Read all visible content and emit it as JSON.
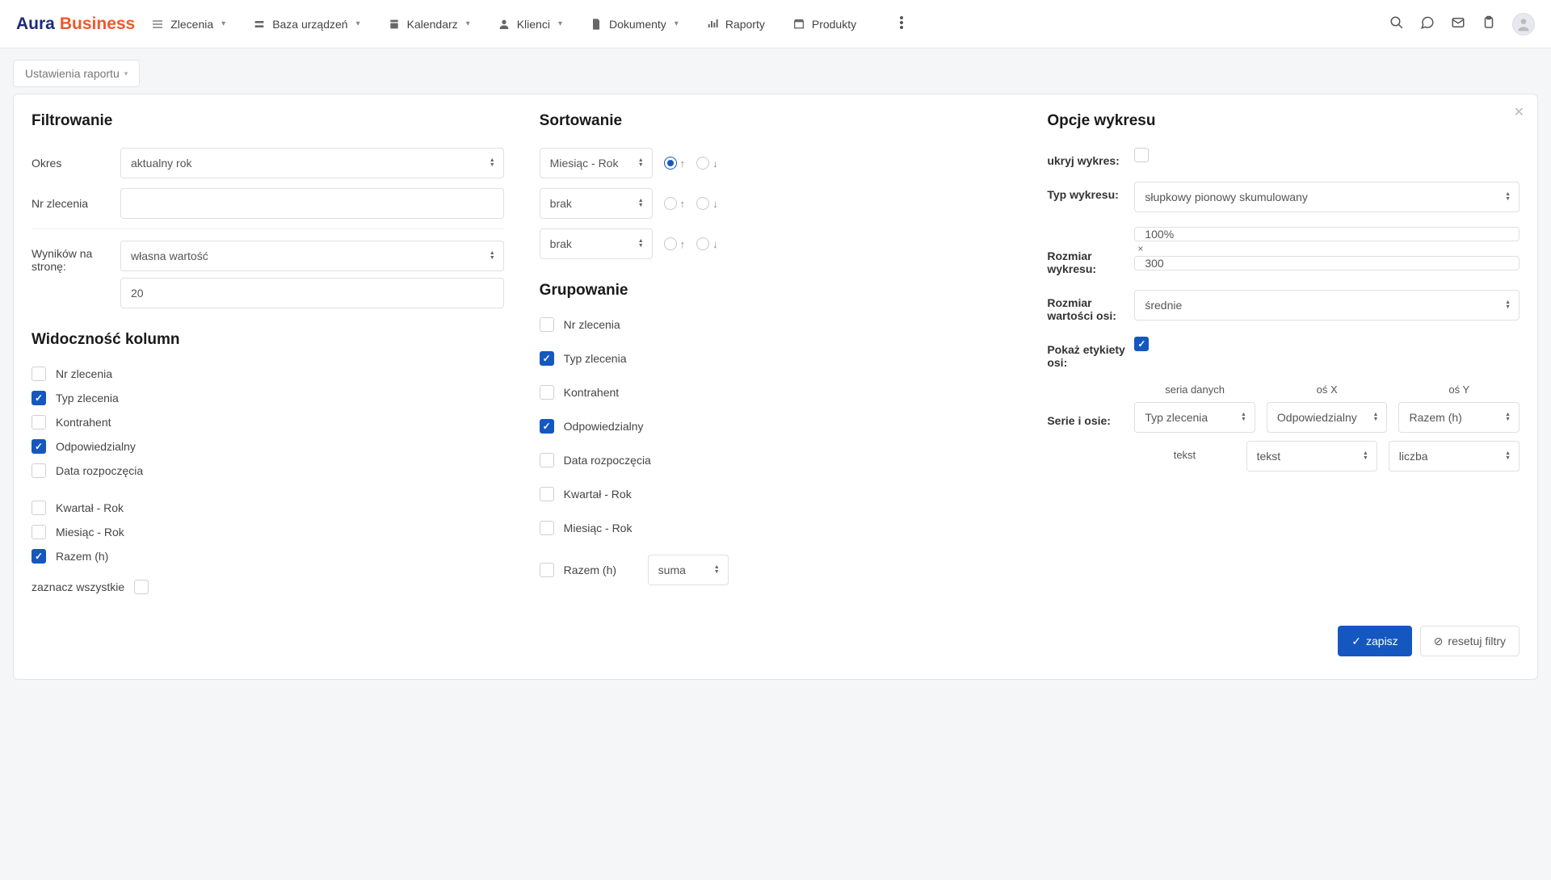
{
  "logo": {
    "part1": "Aura",
    "part2": "Business"
  },
  "nav": {
    "orders": "Zlecenia",
    "devices": "Baza urządzeń",
    "calendar": "Kalendarz",
    "clients": "Klienci",
    "documents": "Dokumenty",
    "reports": "Raporty",
    "products": "Produkty"
  },
  "tab": "Ustawienia raportu",
  "section": {
    "filtering": "Filtrowanie",
    "sorting": "Sortowanie",
    "chart_options": "Opcje wykresu",
    "columns": "Widoczność kolumn",
    "grouping": "Grupowanie"
  },
  "filter": {
    "period_label": "Okres",
    "period_value": "aktualny rok",
    "order_no_label": "Nr zlecenia",
    "order_no_value": "",
    "perpage_label": "Wyników na stronę:",
    "perpage_select": "własna wartość",
    "perpage_value": "20"
  },
  "columns": {
    "items": [
      {
        "label": "Nr zlecenia",
        "checked": false
      },
      {
        "label": "Typ zlecenia",
        "checked": true
      },
      {
        "label": "Kontrahent",
        "checked": false
      },
      {
        "label": "Odpowiedzialny",
        "checked": true
      },
      {
        "label": "Data rozpoczęcia",
        "checked": false
      },
      {
        "label": "Kwartał - Rok",
        "checked": false
      },
      {
        "label": "Miesiąc - Rok",
        "checked": false
      },
      {
        "label": "Razem (h)",
        "checked": true
      }
    ],
    "select_all": "zaznacz wszystkie"
  },
  "sorting": {
    "rows": [
      {
        "value": "Miesiąc - Rok",
        "asc": true
      },
      {
        "value": "brak",
        "asc": null
      },
      {
        "value": "brak",
        "asc": null
      }
    ]
  },
  "grouping": {
    "items": [
      {
        "label": "Nr zlecenia",
        "checked": false
      },
      {
        "label": "Typ zlecenia",
        "checked": true
      },
      {
        "label": "Kontrahent",
        "checked": false
      },
      {
        "label": "Odpowiedzialny",
        "checked": true
      },
      {
        "label": "Data rozpoczęcia",
        "checked": false
      },
      {
        "label": "Kwartał - Rok",
        "checked": false
      },
      {
        "label": "Miesiąc - Rok",
        "checked": false
      }
    ],
    "razem_label": "Razem (h)",
    "razem_value": "suma"
  },
  "chart": {
    "hide_label": "ukryj wykres:",
    "type_label": "Typ wykresu:",
    "type_value": "słupkowy pionowy skumulowany",
    "size_label": "Rozmiar wykresu:",
    "size_w": "100%",
    "size_h": "300",
    "axis_size_label": "Rozmiar wartości osi:",
    "axis_size_value": "średnie",
    "show_labels_label": "Pokaż etykiety osi:",
    "series_label": "Serie i osie:",
    "header_series": "seria danych",
    "header_x": "oś X",
    "header_y": "oś Y",
    "row1_series": "Typ zlecenia",
    "row1_x": "Odpowiedzialny",
    "row1_y": "Razem (h)",
    "row2_text": "tekst",
    "row2_x": "tekst",
    "row2_y": "liczba"
  },
  "buttons": {
    "save": "zapisz",
    "reset": "resetuj filtry"
  }
}
